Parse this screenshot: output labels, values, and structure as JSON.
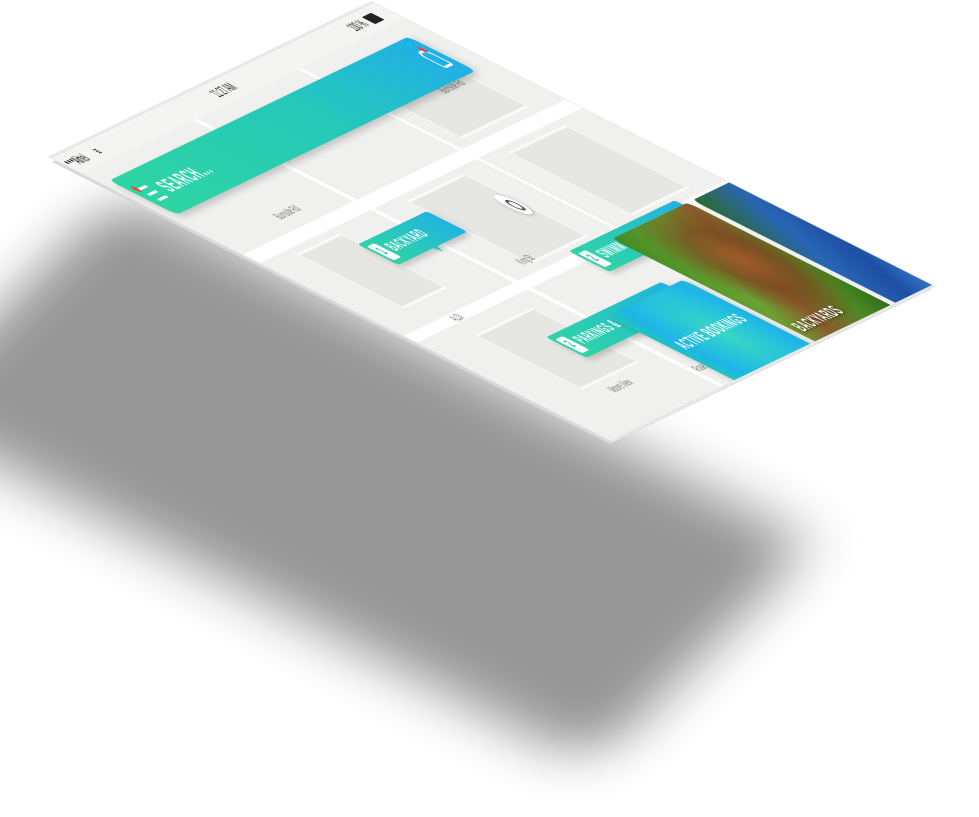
{
  "status_bar": {
    "carrier": "Airtel",
    "time": "11:27 AM",
    "battery": "100 %"
  },
  "search": {
    "label": "SEARCH...",
    "menu_icon": "hamburger-menu-icon",
    "notification_icon": "bell-icon"
  },
  "map": {
    "labels": [
      "Burnside Rd",
      "ALDI",
      "King St",
      "Moore View",
      "Burnside Rd",
      "Rose Bank"
    ]
  },
  "pins": [
    {
      "count": "1",
      "label": "BACKYARD"
    },
    {
      "count": "2",
      "label": "SWIMMING POOLS"
    },
    {
      "count": "2",
      "label": "PARKINGS & GARAGES"
    }
  ],
  "cards": {
    "active_bookings": "ACTIVE BOOKINGS",
    "backyards": "BACKYARDS"
  },
  "colors": {
    "accent_start": "#2ed5a3",
    "accent_end": "#20b0e6",
    "notification_dot": "#ff3b3b"
  }
}
